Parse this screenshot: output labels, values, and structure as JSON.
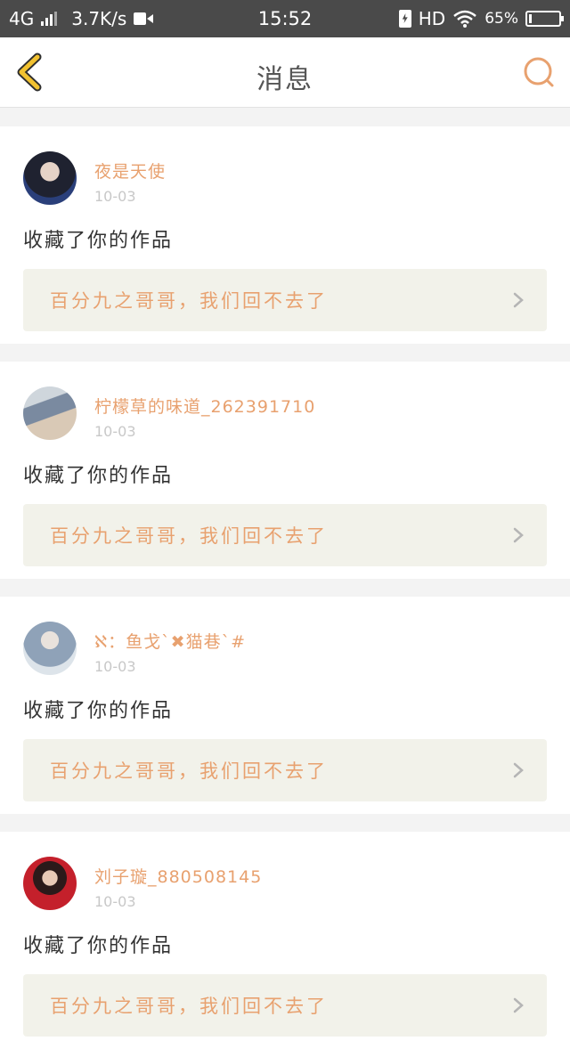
{
  "status_bar": {
    "network": "4G",
    "speed": "3.7K/s",
    "time": "15:52",
    "hd": "HD",
    "battery_percent": "65%"
  },
  "header": {
    "title": "消息",
    "back_icon": "chevron-left-icon",
    "search_icon": "search-icon"
  },
  "colors": {
    "accent": "#e8a16f",
    "back_icon": "#f2c230",
    "link_bg": "#f2f2ea"
  },
  "notifications": [
    {
      "username": "夜是天使",
      "date": "10-03",
      "action": "收藏了你的作品",
      "work_title": "百分九之哥哥，我们回不去了"
    },
    {
      "username": "柠檬草的味道_262391710",
      "date": "10-03",
      "action": "收藏了你的作品",
      "work_title": "百分九之哥哥，我们回不去了"
    },
    {
      "username": "ℵ：鱼戈`✖猫巷`#",
      "date": "10-03",
      "action": "收藏了你的作品",
      "work_title": "百分九之哥哥，我们回不去了"
    },
    {
      "username": "刘子璇_880508145",
      "date": "10-03",
      "action": "收藏了你的作品",
      "work_title": "百分九之哥哥，我们回不去了"
    }
  ]
}
